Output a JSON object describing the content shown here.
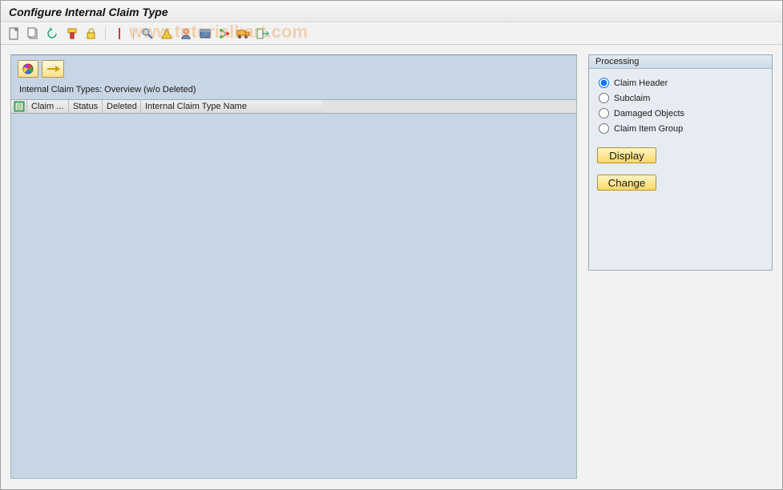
{
  "header": {
    "title": "Configure Internal Claim Type"
  },
  "toolbar_icons": [
    "new-document-icon",
    "copy-icon",
    "undo-icon",
    "filter-icon",
    "lock-icon",
    "pointer-icon",
    "search-icon",
    "measure-icon",
    "user-icon",
    "folder-icon",
    "tree-icon",
    "transport-icon",
    "exit-icon"
  ],
  "watermark": "www.tutorialkart.com",
  "left": {
    "subtitle": "Internal Claim Types: Overview (w/o Deleted)",
    "columns": [
      "Claim ...",
      "Status",
      "Deleted",
      "Internal Claim Type Name"
    ],
    "rows": []
  },
  "right": {
    "title": "Processing",
    "options": [
      {
        "value": "header",
        "label": "Claim Header",
        "selected": true
      },
      {
        "value": "sub",
        "label": "Subclaim",
        "selected": false
      },
      {
        "value": "damaged",
        "label": "Damaged Objects",
        "selected": false
      },
      {
        "value": "group",
        "label": "Claim Item Group",
        "selected": false
      }
    ],
    "display_btn": "Display",
    "change_btn": "Change"
  }
}
